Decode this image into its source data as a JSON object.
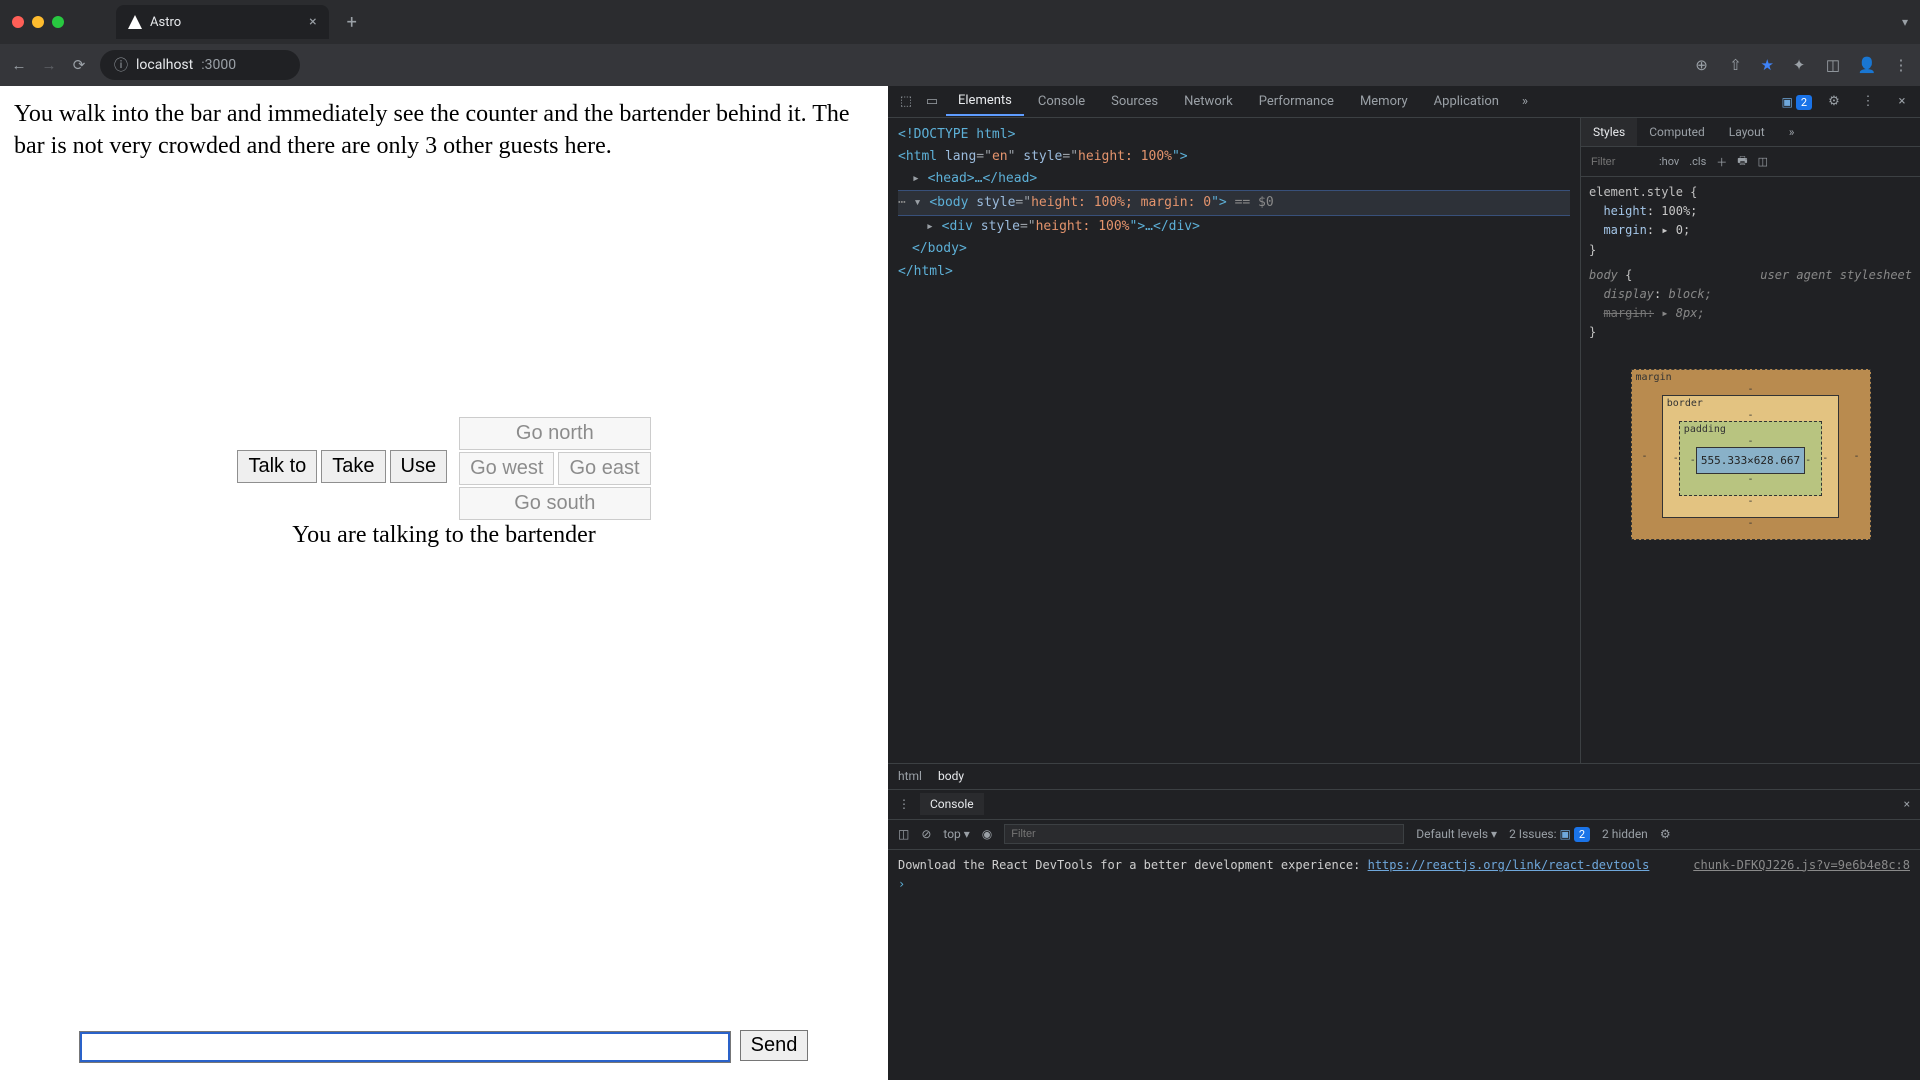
{
  "browser": {
    "tab_title": "Astro",
    "url_host": "localhost",
    "url_port": ":3000"
  },
  "game": {
    "narration": "You walk into the bar and immediately see the counter and the bartender behind it. The bar is not very crowded and there are only 3 other guests here.",
    "buttons": {
      "talk": "Talk to",
      "take": "Take",
      "use": "Use",
      "north": "Go north",
      "west": "Go west",
      "east": "Go east",
      "south": "Go south"
    },
    "status": "You are talking to the bartender",
    "input_value": "",
    "send": "Send"
  },
  "devtools": {
    "tabs": [
      "Elements",
      "Console",
      "Sources",
      "Network",
      "Performance",
      "Memory",
      "Application"
    ],
    "active_tab": "Elements",
    "issue_count": "2",
    "dom_lines": {
      "l0": "<!DOCTYPE html>",
      "l1a": "<html ",
      "l1b": "lang",
      "l1c": "=\"",
      "l1d": "en",
      "l1e": "\" ",
      "l1f": "style",
      "l1g": "=\"",
      "l1h": "height: 100%",
      "l1i": "\">",
      "l2": "<head>…</head>",
      "l3a": "<body ",
      "l3b": "style",
      "l3c": "=\"",
      "l3d": "height: 100%; margin: 0",
      "l3e": "\">",
      "l3f": " == $0",
      "l4a": "<div ",
      "l4b": "style",
      "l4c": "=\"",
      "l4d": "height: 100%",
      "l4e": "\">…</div>",
      "l5": "</body>",
      "l6": "</html>"
    },
    "breadcrumbs": [
      "html",
      "body"
    ],
    "styles": {
      "tabs": [
        "Styles",
        "Computed",
        "Layout"
      ],
      "active": "Styles",
      "filter_placeholder": "Filter",
      "hov": ":hov",
      "cls": ".cls",
      "rule1_sel": "element.style",
      "rule1_p1n": "height",
      "rule1_p1v": "100%;",
      "rule1_p2n": "margin",
      "rule1_p2v": "▸ 0;",
      "rule2_sel": "body",
      "rule2_src": "user agent stylesheet",
      "rule2_p1n": "display",
      "rule2_p1v": "block;",
      "rule2_p2n": "margin:",
      "rule2_p2v": "▸ 8px;",
      "box": {
        "margin": "margin",
        "border": "border",
        "padding": "padding",
        "content": "555.333×628.667"
      }
    },
    "console": {
      "label": "Console",
      "context": "top",
      "filter_placeholder": "Filter",
      "levels": "Default levels",
      "issues": "2 Issues:",
      "issues_n": "2",
      "hidden": "2 hidden",
      "source": "chunk-DFKQJ226.js?v=9e6b4e8c:8",
      "msg": "Download the React DevTools for a better development experience: ",
      "link": "https://reactjs.org/link/react-devtools"
    }
  }
}
